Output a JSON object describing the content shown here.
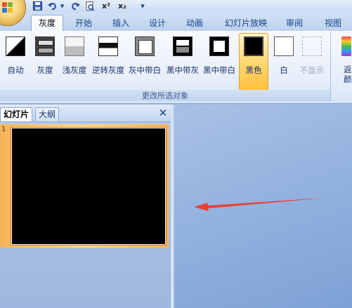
{
  "tabs": [
    "灰度",
    "开始",
    "插入",
    "设计",
    "动画",
    "幻灯片放映",
    "审阅",
    "视图"
  ],
  "active_tab": "灰度",
  "buttons": [
    {
      "label": "自动",
      "swatch": "auto"
    },
    {
      "label": "灰度",
      "swatch": "gray"
    },
    {
      "label": "浅灰度",
      "swatch": "lightgray"
    },
    {
      "label": "逆转灰度",
      "swatch": "inverse"
    },
    {
      "label": "灰中带白",
      "swatch": "graywhite"
    },
    {
      "label": "黑中带灰",
      "swatch": "blackgray"
    },
    {
      "label": "黑中带白",
      "swatch": "blackwhite"
    },
    {
      "label": "黑色",
      "swatch": "black"
    },
    {
      "label": "白",
      "swatch": "white"
    },
    {
      "label": "不显示",
      "swatch": "none"
    }
  ],
  "selected_button": "黑色",
  "group_label": "更改所选对象",
  "right_button_label": "返\n颜色",
  "pane": {
    "tabs": [
      "幻灯片",
      "大纲"
    ],
    "active_tab": "幻灯片",
    "slide_number": "1"
  },
  "colors": {
    "ribbon_bg": "#e6eefa",
    "active_button": "#ffd873",
    "arrow": "#e8402f"
  }
}
